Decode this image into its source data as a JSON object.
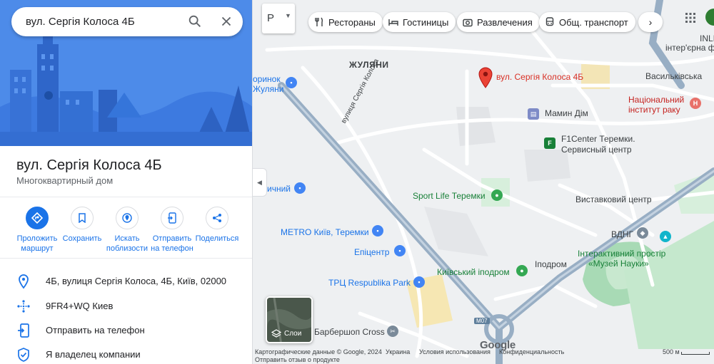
{
  "search": {
    "query": "вул. Сергія Колоса 4Б"
  },
  "place": {
    "title": "вул. Сергія Колоса 4Б",
    "type": "Многоквартирный дом"
  },
  "actions": [
    {
      "label": "Проложить маршрут",
      "icon": "directions-icon"
    },
    {
      "label": "Сохранить",
      "icon": "bookmark-icon"
    },
    {
      "label": "Искать поблизости",
      "icon": "nearby-icon"
    },
    {
      "label": "Отправить на телефон",
      "icon": "send-to-phone-icon"
    },
    {
      "label": "Поделиться",
      "icon": "share-icon"
    }
  ],
  "info": [
    {
      "text": "4Б, вулиця Сергія Колоса, 4Б, Київ, 02000",
      "icon": "location-pin-icon"
    },
    {
      "text": "9FR4+WQ Киев",
      "icon": "plus-code-icon"
    },
    {
      "text": "Отправить на телефон",
      "icon": "send-to-phone-icon"
    },
    {
      "text": "Я владелец компании",
      "icon": "shield-check-icon"
    }
  ],
  "map": {
    "type_button": "Р",
    "chips": [
      {
        "label": "Рестораны",
        "icon": "fork-knife-icon"
      },
      {
        "label": "Гостиницы",
        "icon": "bed-icon"
      },
      {
        "label": "Развлечения",
        "icon": "camera-icon"
      },
      {
        "label": "Общ. транспорт",
        "icon": "bus-icon"
      }
    ],
    "labels": {
      "zhuliany": "ЖУЛЯНИ",
      "pin": "вул. Сергія Колоса 4Б",
      "mamyn_dim": "Мамин Дім",
      "f1center_1": "F1Center Теремки.",
      "f1center_2": "Сервисный центр",
      "sport_life": "Sport Life Теремки",
      "vystavkovyi": "Виставковий центр",
      "metro": "METRO Київ, Теремки",
      "epicentr": "Епіцентр",
      "respublika": "ТРЦ Respublika Park",
      "ipodrom": "Київський іподром",
      "ipodrom_metro": "Іподром",
      "vdng": "ВДНГ",
      "muzei_1": "Інтерактивний простір",
      "muzei_2": "«Музей Науки»",
      "barbershop": "Барбершоп Cross",
      "natsionalnyi_1": "Національний",
      "natsionalnyi_2": "інститут раку",
      "vasylkivska": "Васильківська",
      "inlight_1": "INLIG",
      "inlight_2": "інтер'єрна фото",
      "street_koliosa": "вулиця Сергія Колоса",
      "left_1": "оринок",
      "left_2": "Жуляни",
      "left_3": "ичний",
      "road_m07": "M07"
    },
    "layers_label": "Слои",
    "logo": "Google",
    "footer": {
      "data": "Картографические данные © Google, 2024",
      "country": "Украина",
      "terms": "Условия использования",
      "privacy": "Конфиденциальность",
      "feedback": "Отправить отзыв о продукте",
      "scale": "500 м"
    }
  }
}
